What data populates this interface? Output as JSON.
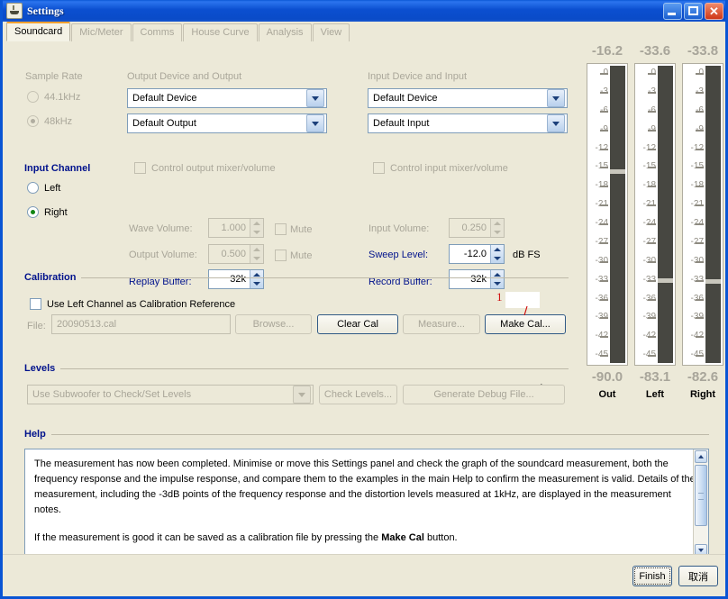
{
  "window": {
    "title": "Settings",
    "icon": "java-coffee-cup-icon",
    "minimize": "minimize-button",
    "maximize": "maximize-button",
    "close": "close-button"
  },
  "tabs": [
    {
      "label": "Soundcard",
      "active": true,
      "enabled": true
    },
    {
      "label": "Mic/Meter",
      "active": false,
      "enabled": false
    },
    {
      "label": "Comms",
      "active": false,
      "enabled": false
    },
    {
      "label": "House Curve",
      "active": false,
      "enabled": false
    },
    {
      "label": "Analysis",
      "active": false,
      "enabled": false
    },
    {
      "label": "View",
      "active": false,
      "enabled": false
    }
  ],
  "sample_rate": {
    "label": "Sample Rate",
    "options": [
      {
        "label": "44.1kHz",
        "selected": false
      },
      {
        "label": "48kHz",
        "selected": true
      }
    ]
  },
  "input_channel": {
    "label": "Input Channel",
    "options": [
      {
        "label": "Left",
        "selected": false
      },
      {
        "label": "Right",
        "selected": true
      }
    ]
  },
  "output_device": {
    "label": "Output Device and Output",
    "device": "Default Device",
    "output": "Default Output",
    "control_mixer_label": "Control output mixer/volume",
    "control_mixer_checked": false,
    "wave_volume_label": "Wave Volume:",
    "wave_volume_value": "1.000",
    "wave_mute_label": "Mute",
    "output_volume_label": "Output Volume:",
    "output_volume_value": "0.500",
    "output_mute_label": "Mute",
    "replay_buffer_label": "Replay Buffer:",
    "replay_buffer_value": "32k"
  },
  "input_device": {
    "label": "Input Device and Input",
    "device": "Default Device",
    "input": "Default Input",
    "control_mixer_label": "Control input mixer/volume",
    "control_mixer_checked": false,
    "input_volume_label": "Input Volume:",
    "input_volume_value": "0.250",
    "sweep_level_label": "Sweep Level:",
    "sweep_level_value": "-12.0",
    "sweep_level_units": "dB FS",
    "record_buffer_label": "Record Buffer:",
    "record_buffer_value": "32k"
  },
  "calibration": {
    "section_label": "Calibration",
    "use_left_label": "Use Left Channel as Calibration Reference",
    "use_left_checked": false,
    "file_label": "File:",
    "file_value": "20090513.cal",
    "browse_label": "Browse...",
    "clear_cal_label": "Clear Cal",
    "measure_label": "Measure...",
    "make_cal_label": "Make Cal..."
  },
  "levels": {
    "section_label": "Levels",
    "subwoofer_select": "Use Subwoofer to Check/Set Levels",
    "check_levels_label": "Check Levels...",
    "generate_debug_label": "Generate Debug File..."
  },
  "help": {
    "section_label": "Help",
    "paragraph1": "The measurement has now been completed. Minimise or move this Settings panel and check the graph of the soundcard measurement, both the frequency response and the impulse response, and compare them to the examples in the main Help to confirm the measurement is valid. Details of the measurement, including the -3dB points of the frequency response and the distortion levels measured at 1kHz, are displayed in the measurement notes.",
    "paragraph2_pre": "If the measurement is good it can be saved as a calibration file by pressing the ",
    "paragraph2_bold": "Make Cal",
    "paragraph2_post": " button."
  },
  "meters": {
    "scale_labels": [
      "0",
      "-3",
      "-6",
      "-9",
      "-12",
      "-15",
      "-18",
      "-21",
      "-24",
      "-27",
      "-30",
      "-33",
      "-36",
      "-39",
      "-42",
      "-45"
    ],
    "channels": [
      {
        "name": "Out",
        "peak": "-16.2",
        "rms": "-90.0",
        "marker_db": -16.2
      },
      {
        "name": "Left",
        "peak": "-33.6",
        "rms": "-83.1",
        "marker_db": -33.6
      },
      {
        "name": "Right",
        "peak": "-33.8",
        "rms": "-82.6",
        "marker_db": -33.8
      }
    ]
  },
  "annotation": {
    "number": "1"
  },
  "footer": {
    "finish_label": "Finish",
    "cancel_label": "取消"
  },
  "colors": {
    "title_blue": "#0a4bc8",
    "section_heading": "#00128c",
    "label_blue": "#00128c",
    "annotation_red": "#d01010",
    "active_tab_accent": "#f0a030",
    "panel_bg": "#ece9d8"
  }
}
